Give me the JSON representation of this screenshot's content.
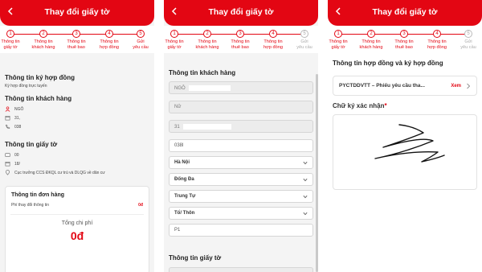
{
  "header": {
    "title": "Thay đổi giấy tờ"
  },
  "steps": [
    {
      "num": "1",
      "line1": "Thông tin",
      "line2": "giấy tờ"
    },
    {
      "num": "2",
      "line1": "Thông tin",
      "line2": "khách hàng"
    },
    {
      "num": "3",
      "line1": "Thông tin",
      "line2": "thuê bao"
    },
    {
      "num": "4",
      "line1": "Thông tin",
      "line2": "hợp đồng"
    },
    {
      "num": "5",
      "line1": "Gửi",
      "line2": "yêu cầu"
    }
  ],
  "panel1": {
    "contract_title": "Thông tin ký hợp đồng",
    "contract_sub": "Ký hợp đồng trực tuyến",
    "customer_title": "Thông tin khách hàng",
    "customer_name": "NGÔ",
    "customer_dob": "31,",
    "customer_phone": "038",
    "doc_title": "Thông tin giấy tờ",
    "doc_number": "00",
    "doc_date": "18/",
    "doc_issuer": "Cục trưởng CCS ĐKQL cư trú và DLQG về dân cư",
    "order_title": "Thông tin đơn hàng",
    "fee_label": "Phí thay đổi thông tin",
    "fee_value": "0đ",
    "total_label": "Tổng chi phí",
    "total_value": "0đ"
  },
  "panel2": {
    "section_title": "Thông tin khách hàng",
    "name_value": "NGÔ",
    "gender_value": "Nữ",
    "dob_value": "31",
    "phone_value": "038l",
    "province_value": "Hà Nội",
    "district_value": "Đống Đa",
    "ward_value": "Trung Tự",
    "hamlet_placeholder": "Tổ/ Thôn",
    "address_value": "P1",
    "doc_section_title": "Thông tin giấy tờ"
  },
  "panel3": {
    "section_title": "Thông tin hợp đồng và ký hợp đồng",
    "contract_item": "PYCTDDVTT – Phiếu yêu cầu tha...",
    "view_label": "Xem",
    "signature_label": "Chữ ký xác nhận",
    "required_mark": "*"
  },
  "colors": {
    "brand": "#e30613"
  }
}
